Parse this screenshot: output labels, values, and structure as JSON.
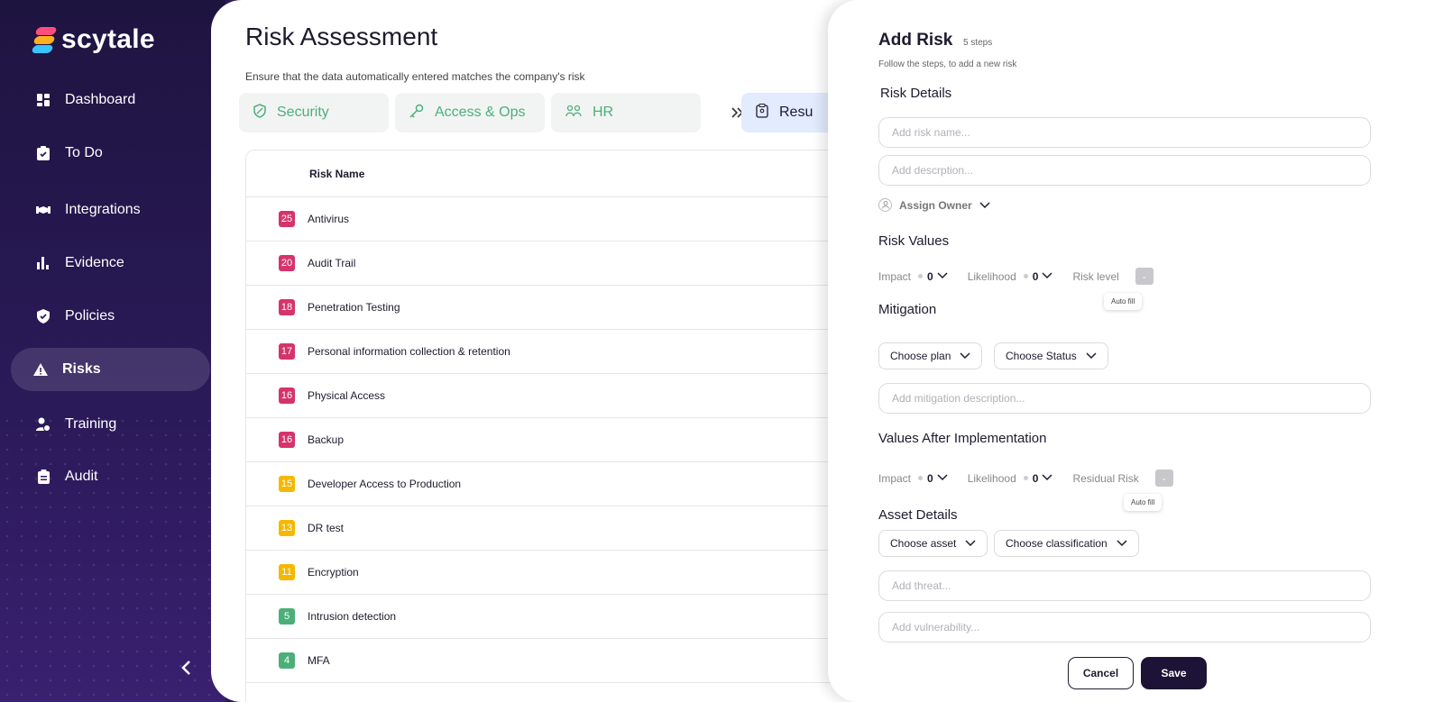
{
  "brand": {
    "name": "scytale"
  },
  "sidebar": {
    "items": [
      {
        "label": "Dashboard",
        "icon": "dashboard-icon"
      },
      {
        "label": "To Do",
        "icon": "clipboard-check-icon"
      },
      {
        "label": "Integrations",
        "icon": "handshake-icon"
      },
      {
        "label": "Evidence",
        "icon": "bar-chart-icon"
      },
      {
        "label": "Policies",
        "icon": "shield-check-icon"
      },
      {
        "label": "Risks",
        "icon": "warning-icon",
        "active": true
      },
      {
        "label": "Training",
        "icon": "user-check-icon"
      },
      {
        "label": "Audit",
        "icon": "clipboard-list-icon"
      }
    ]
  },
  "main": {
    "title": "Risk Assessment",
    "subtitle": "Ensure that the data automatically entered matches the company's risk",
    "categories": [
      {
        "label": "Security",
        "icon": "shield-icon"
      },
      {
        "label": "Access & Ops",
        "icon": "key-icon"
      },
      {
        "label": "HR",
        "icon": "people-icon"
      },
      {
        "label": "Resu",
        "icon": "report-icon"
      }
    ],
    "table": {
      "header": "Risk Name",
      "rows": [
        {
          "score": "25",
          "name": "Antivirus",
          "color": "#d6336c"
        },
        {
          "score": "20",
          "name": "Audit Trail",
          "color": "#d6336c"
        },
        {
          "score": "18",
          "name": "Penetration Testing",
          "color": "#d6336c"
        },
        {
          "score": "17",
          "name": "Personal information collection & retention",
          "color": "#d6336c"
        },
        {
          "score": "16",
          "name": "Physical Access",
          "color": "#d6336c"
        },
        {
          "score": "16",
          "name": "Backup",
          "color": "#d6336c"
        },
        {
          "score": "15",
          "name": "Developer Access to Production",
          "color": "#f5b800"
        },
        {
          "score": "13",
          "name": "DR test",
          "color": "#f5b800"
        },
        {
          "score": "11",
          "name": "Encryption",
          "color": "#f5b800"
        },
        {
          "score": "5",
          "name": "Intrusion detection",
          "color": "#4caf7a"
        },
        {
          "score": "4",
          "name": "MFA",
          "color": "#4caf7a"
        }
      ]
    }
  },
  "drawer": {
    "title": "Add Risk",
    "steps": "5 steps",
    "subtitle": "Follow the steps, to add a new risk",
    "risk_details": {
      "heading": "Risk Details",
      "name_placeholder": "Add risk name...",
      "desc_placeholder": "Add descrption...",
      "owner_label": "Assign Owner"
    },
    "risk_values": {
      "heading": "Risk Values",
      "impact_label": "Impact",
      "impact_value": "0",
      "likelihood_label": "Likelihood",
      "likelihood_value": "0",
      "level_label": "Risk level",
      "level_value": "-",
      "tooltip": "Auto fill"
    },
    "mitigation": {
      "heading": "Mitigation",
      "plan_label": "Choose plan",
      "status_label": "Choose Status",
      "desc_placeholder": "Add mitigation description..."
    },
    "after": {
      "heading": "Values After Implementation",
      "impact_label": "Impact",
      "impact_value": "0",
      "likelihood_label": "Likelihood",
      "likelihood_value": "0",
      "residual_label": "Residual Risk",
      "residual_value": "-",
      "tooltip": "Auto fill"
    },
    "asset": {
      "heading": "Asset Details",
      "asset_label": "Choose asset",
      "classification_label": "Choose classification",
      "threat_placeholder": "Add threat...",
      "vulnerability_placeholder": "Add vulnerability..."
    },
    "buttons": {
      "cancel": "Cancel",
      "save": "Save"
    }
  }
}
